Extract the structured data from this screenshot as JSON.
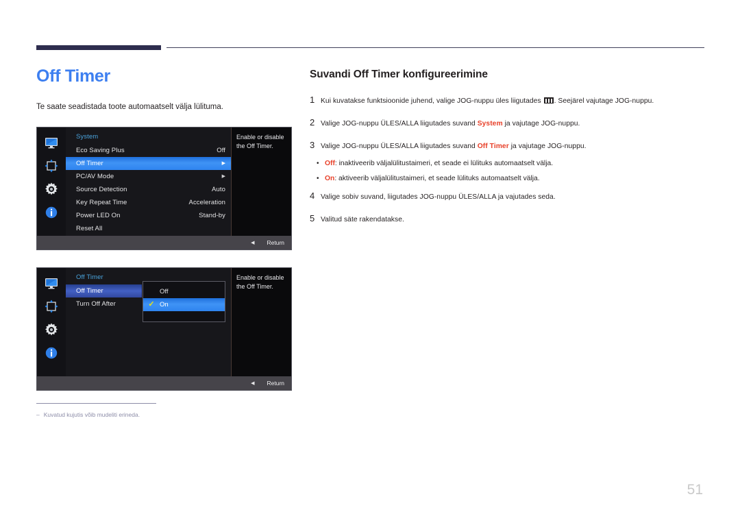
{
  "page": {
    "title": "Off Timer",
    "intro": "Te saate seadistada toote automaatselt välja lülituma.",
    "number": "51",
    "footnote_dash": "‒",
    "footnote": "Kuvatud kujutis võib mudeliti erineda.",
    "accent_blue": "#3d7ff0",
    "accent_red": "#e8412a",
    "rule_navy": "#2e2d4e"
  },
  "right": {
    "section_title": "Suvandi Off Timer konfigureerimine",
    "steps": [
      {
        "num": "1",
        "parts": [
          {
            "t": "Kui kuvatakse funktsioonide juhend, valige JOG-nuppu üles liigutades "
          },
          {
            "icon": "function-guide-icon"
          },
          {
            "t": ". Seejärel vajutage JOG-nuppu."
          }
        ]
      },
      {
        "num": "2",
        "parts": [
          {
            "t": "Valige JOG-nuppu ÜLES/ALLA liigutades suvand "
          },
          {
            "t": "System",
            "accent": true
          },
          {
            "t": " ja vajutage JOG-nuppu."
          }
        ]
      },
      {
        "num": "3",
        "parts": [
          {
            "t": "Valige JOG-nuppu ÜLES/ALLA liigutades suvand "
          },
          {
            "t": "Off Timer",
            "accent": true
          },
          {
            "t": " ja vajutage JOG-nuppu."
          }
        ]
      }
    ],
    "bullets": [
      {
        "dot": "•",
        "accent": "Off",
        "rest": ": inaktiveerib väljalülitustaimeri, et seade ei lülituks automaatselt välja."
      },
      {
        "dot": "•",
        "accent": "On",
        "rest": ": aktiveerib väljalülitustaimeri, et seade lülituks automaatselt välja."
      }
    ],
    "steps_after": [
      {
        "num": "4",
        "text": "Valige sobiv suvand, liigutades JOG-nuppu ÜLES/ALLA ja vajutades seda."
      },
      {
        "num": "5",
        "text": "Valitud säte rakendatakse."
      }
    ]
  },
  "osd1": {
    "menu_title": "System",
    "icons": [
      "monitor-icon",
      "move-arrows-icon",
      "gear-icon",
      "info-icon"
    ],
    "rows": [
      {
        "label": "Eco Saving Plus",
        "value": "Off",
        "arrow": "",
        "selected": false
      },
      {
        "label": "Off Timer",
        "value": "",
        "arrow": "▶",
        "selected": true
      },
      {
        "label": "PC/AV Mode",
        "value": "",
        "arrow": "▶",
        "selected": false
      },
      {
        "label": "Source Detection",
        "value": "Auto",
        "arrow": "",
        "selected": false
      },
      {
        "label": "Key Repeat Time",
        "value": "Acceleration",
        "arrow": "",
        "selected": false
      },
      {
        "label": "Power LED On",
        "value": "Stand-by",
        "arrow": "",
        "selected": false
      },
      {
        "label": "Reset All",
        "value": "",
        "arrow": "",
        "selected": false
      }
    ],
    "help": "Enable or disable the Off Timer.",
    "footer_back": "◀",
    "footer_return": "Return"
  },
  "osd2": {
    "menu_title": "Off Timer",
    "icons": [
      "monitor-icon",
      "move-arrows-icon",
      "gear-icon",
      "info-icon"
    ],
    "rows": [
      {
        "label": "Off Timer",
        "selected_dim": true
      },
      {
        "label": "Turn Off After",
        "selected_dim": false
      }
    ],
    "dropdown": [
      {
        "label": "Off",
        "check": "",
        "selected": false
      },
      {
        "label": "On",
        "check": "✓",
        "selected": true
      }
    ],
    "help": "Enable or disable the Off Timer.",
    "footer_back": "◀",
    "footer_return": "Return"
  }
}
